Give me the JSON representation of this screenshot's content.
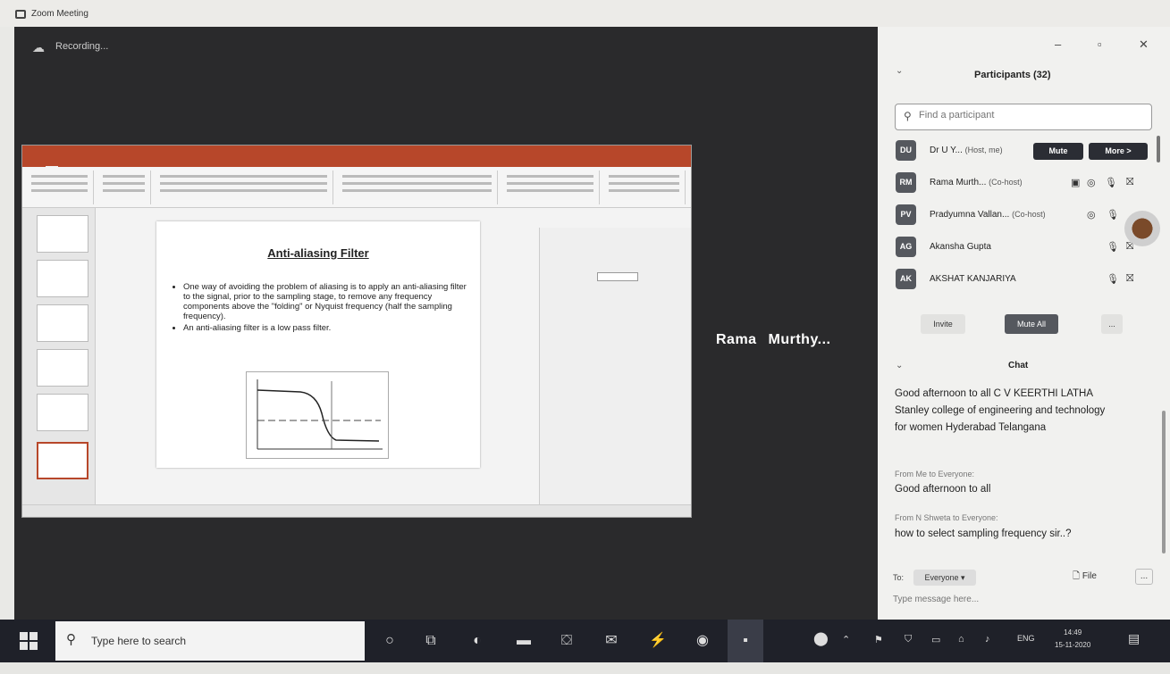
{
  "window": {
    "title": "Zoom Meeting"
  },
  "recording": {
    "label": "Recording..."
  },
  "speaker": {
    "name": "Rama  Murthy..."
  },
  "slide": {
    "title": "Anti-aliasing Filter",
    "bullets": [
      "One way of avoiding the problem of aliasing is to apply an anti-aliasing filter to the signal, prior to the sampling stage, to remove any frequency components above the \"folding\" or Nyquist frequency (half the sampling frequency).",
      "An anti-aliasing filter is a low pass filter."
    ]
  },
  "participants": {
    "title": "Participants (32)",
    "search_placeholder": "Find a participant",
    "list": [
      {
        "initials": "DU",
        "name": "Dr U Y...",
        "tag": "(Host, me)"
      },
      {
        "initials": "RM",
        "name": "Rama Murth...",
        "tag": "(Co-host)"
      },
      {
        "initials": "PV",
        "name": "Pradyumna Vallan...",
        "tag": "(Co-host)"
      },
      {
        "initials": "AG",
        "name": "Akansha Gupta",
        "tag": ""
      },
      {
        "initials": "AK",
        "name": "AKSHAT KANJARIYA",
        "tag": ""
      }
    ],
    "mute_label": "Mute",
    "more_label": "More >",
    "invite_label": "Invite",
    "mute_all_label": "Mute All",
    "overflow_label": "..."
  },
  "chat": {
    "title": "Chat",
    "first_message": "Good afternoon to all C V KEERTHI LATHA Stanley college of engineering and technology for women Hyderabad Telangana",
    "messages": [
      {
        "from": "From Me to Everyone:",
        "text": "Good afternoon to all"
      },
      {
        "from": "From N Shweta to Everyone:",
        "text": "how to select sampling frequency sir..?"
      }
    ],
    "to_label": "To:",
    "to_value": "Everyone ▾",
    "file_label": "File",
    "more_label": "...",
    "input_placeholder": "Type message here..."
  },
  "taskbar": {
    "search_placeholder": "Type here to search",
    "language": "ENG",
    "time": "14:49",
    "date": "15-11-2020"
  }
}
